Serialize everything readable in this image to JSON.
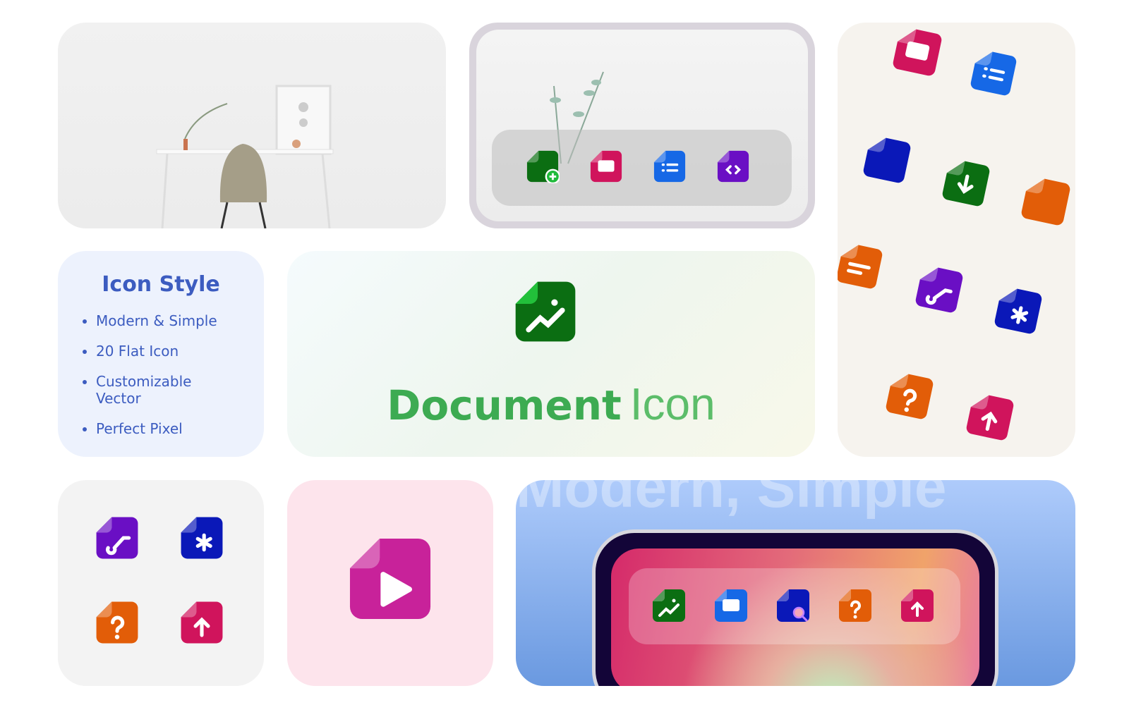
{
  "style_card": {
    "title": "Icon Style",
    "items": [
      "Modern & Simple",
      "20 Flat Icon",
      "Customizable Vector",
      "Perfect Pixel"
    ]
  },
  "hero": {
    "title_bold": "Document",
    "title_light": "Icon",
    "icon": "document-chart-icon",
    "colors": {
      "body": "#0b6e12",
      "fold": "#22c03a"
    }
  },
  "banner": {
    "watermark": "Modern, Simple"
  },
  "colors": {
    "green": "#0b6e12",
    "pink": "#d0145c",
    "blue": "#1668e6",
    "purple": "#6a0fc4",
    "navy": "#0a18b8",
    "orange": "#e25d08",
    "magenta": "#c8229a"
  },
  "mockup_icons": [
    {
      "name": "document-add-icon",
      "color": "green",
      "glyph": "plus"
    },
    {
      "name": "document-window-icon",
      "color": "pink",
      "glyph": "window"
    },
    {
      "name": "clipboard-list-icon",
      "color": "blue",
      "glyph": "list"
    },
    {
      "name": "document-code-icon",
      "color": "purple",
      "glyph": "code"
    }
  ],
  "pattern_icons": [
    {
      "name": "document-window-icon",
      "color": "pink",
      "glyph": "window"
    },
    {
      "name": "clipboard-list-icon",
      "color": "blue",
      "glyph": "list"
    },
    {
      "name": "document-blank-icon",
      "color": "navy",
      "glyph": "none"
    },
    {
      "name": "document-download-icon",
      "color": "green",
      "glyph": "down"
    },
    {
      "name": "folder-icon",
      "color": "orange",
      "glyph": "none"
    },
    {
      "name": "notepad-icon",
      "color": "orange",
      "glyph": "lines"
    },
    {
      "name": "document-music-icon",
      "color": "purple",
      "glyph": "music"
    },
    {
      "name": "document-asterisk-icon",
      "color": "navy",
      "glyph": "star"
    },
    {
      "name": "document-question-icon",
      "color": "orange",
      "glyph": "q"
    },
    {
      "name": "document-upload-icon",
      "color": "pink",
      "glyph": "up"
    }
  ],
  "grid_icons": [
    {
      "name": "document-music-icon",
      "color": "purple",
      "glyph": "music"
    },
    {
      "name": "document-asterisk-icon",
      "color": "navy",
      "glyph": "star"
    },
    {
      "name": "document-question-icon",
      "color": "orange",
      "glyph": "q"
    },
    {
      "name": "document-upload-icon",
      "color": "pink",
      "glyph": "up"
    }
  ],
  "feature_icon": {
    "name": "document-video-icon",
    "color": "magenta",
    "glyph": "play"
  },
  "dock_icons": [
    {
      "name": "document-chart-icon",
      "color": "green",
      "glyph": "chart"
    },
    {
      "name": "window-icon",
      "color": "blue",
      "glyph": "window"
    },
    {
      "name": "document-search-icon",
      "color": "navy",
      "glyph": "search"
    },
    {
      "name": "document-question-icon",
      "color": "orange",
      "glyph": "q"
    },
    {
      "name": "document-upload-icon",
      "color": "pink",
      "glyph": "up"
    }
  ]
}
